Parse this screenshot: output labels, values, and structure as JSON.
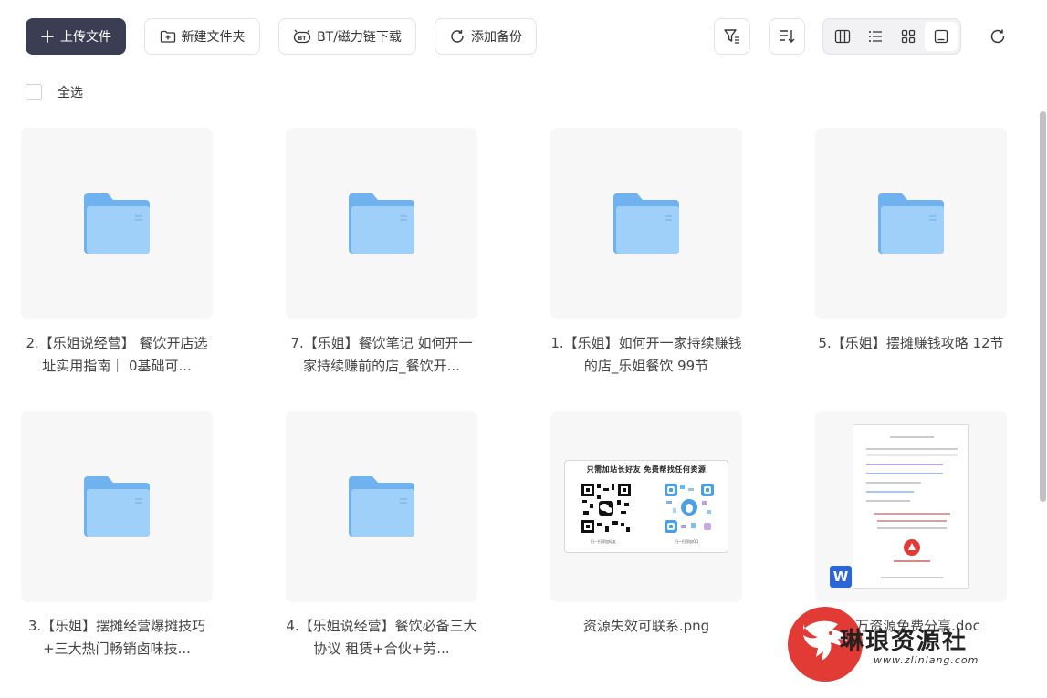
{
  "toolbar": {
    "upload_label": "上传文件",
    "new_folder_label": "新建文件夹",
    "bt_label": "BT/磁力链下载",
    "add_backup_label": "添加备份"
  },
  "select_all_label": "全选",
  "items": [
    {
      "name": "2.【乐姐说经营】 餐饮开店选址实用指南｜ 0基础可...",
      "type": "folder"
    },
    {
      "name": "7.【乐姐】餐饮笔记 如何开一家持续赚前的店_餐饮开...",
      "type": "folder"
    },
    {
      "name": "1.【乐姐】如何开一家持续赚钱的店_乐姐餐饮 99节",
      "type": "folder"
    },
    {
      "name": "5.【乐姐】摆摊赚钱攻略 12节",
      "type": "folder"
    },
    {
      "name": "3.【乐姐】摆摊经营爆摊技巧+三大热门畅销卤味技...",
      "type": "folder"
    },
    {
      "name": "4.【乐姐说经营】餐饮必备三大协议 租赁+合伙+劳...",
      "type": "folder"
    },
    {
      "name": "资源失效可联系.png",
      "type": "image"
    },
    {
      "name": "万万资源免费分享.doc",
      "type": "doc"
    }
  ],
  "qr_image": {
    "title": "只需加站长好友 免费帮找任何资源",
    "caption_left": "扫一扫添加好友",
    "caption_right": "扫一扫添加QQ"
  },
  "doc_badge": "W",
  "watermark": {
    "text": "琳琅资源社",
    "url": "www.zlinlang.com"
  },
  "colors": {
    "primary_button": "#3b3d52",
    "folder": "#8cc3f5",
    "word_badge": "#2b65d9",
    "watermark_red": "#e23b35"
  }
}
